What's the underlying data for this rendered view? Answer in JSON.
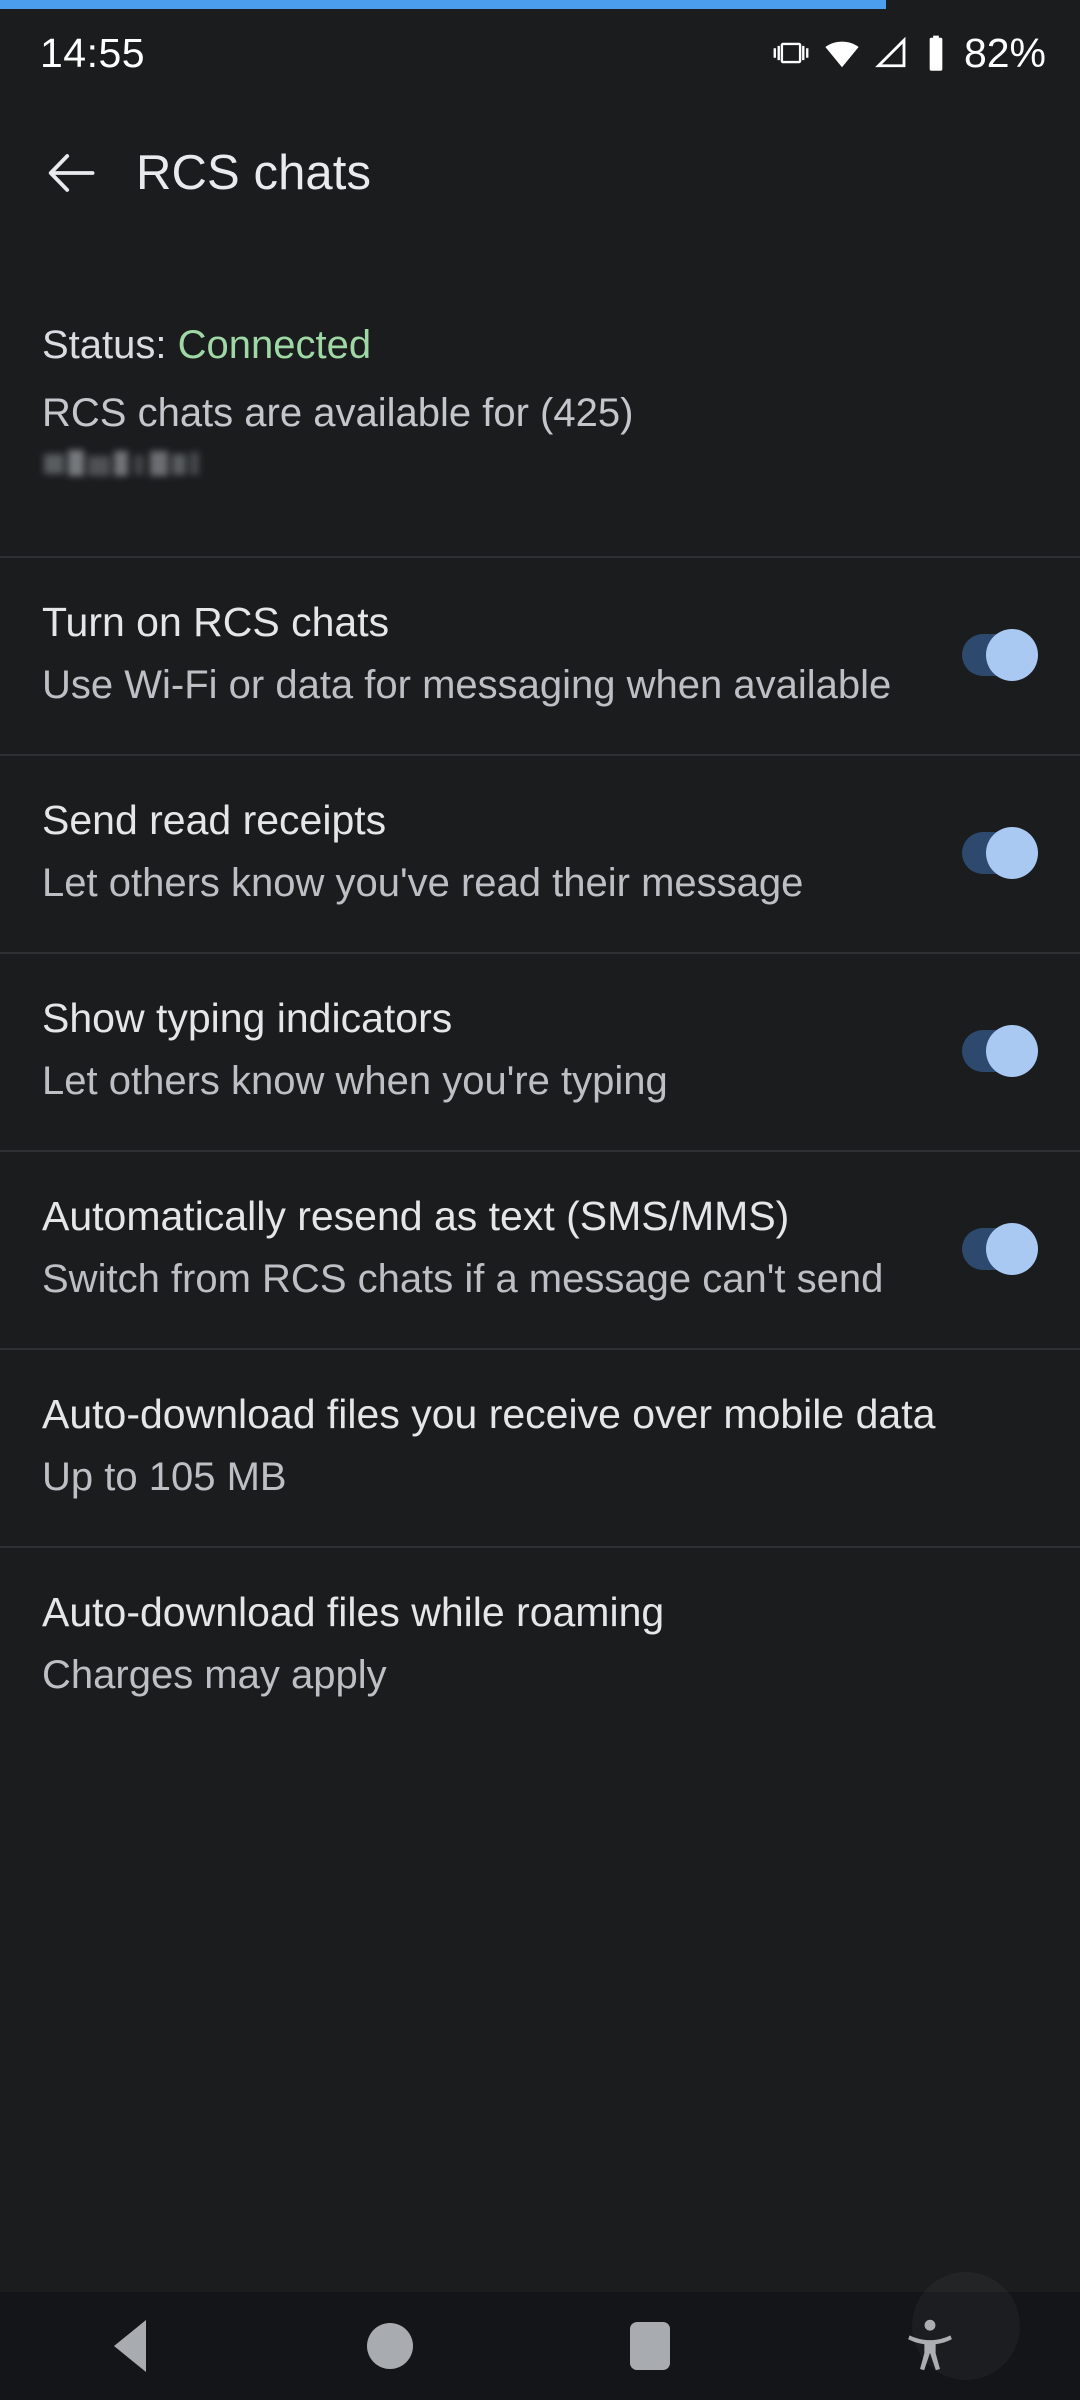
{
  "status_bar": {
    "clock": "14:55",
    "battery_percent": "82%",
    "icons": [
      "vibrate-icon",
      "wifi-icon",
      "cell-signal-icon",
      "battery-icon"
    ]
  },
  "progress": {
    "percent": 82,
    "color": "#4a9eed"
  },
  "app_bar": {
    "back_icon": "back-arrow-icon",
    "title": "RCS chats"
  },
  "status_section": {
    "status_label": "Status: ",
    "status_value": "Connected",
    "status_value_color": "#9fd8a4",
    "availability": "RCS chats are available for (425)",
    "phone_number_redacted": true
  },
  "settings": [
    {
      "title": "Turn on RCS chats",
      "subtitle": "Use Wi-Fi or data for messaging when available",
      "control": "toggle",
      "value": "on"
    },
    {
      "title": "Send read receipts",
      "subtitle": "Let others know you've read their message",
      "control": "toggle",
      "value": "on"
    },
    {
      "title": "Show typing indicators",
      "subtitle": "Let others know when you're typing",
      "control": "toggle",
      "value": "on"
    },
    {
      "title": "Automatically resend as text (SMS/MMS)",
      "subtitle": "Switch from RCS chats if a message can't send",
      "control": "toggle",
      "value": "on"
    },
    {
      "title": "Auto-download files you receive over mobile data",
      "subtitle": "Up to 105 MB",
      "control": "none",
      "value": ""
    },
    {
      "title": "Auto-download files while roaming",
      "subtitle": "Charges may apply",
      "control": "none",
      "value": ""
    }
  ],
  "nav_bar": {
    "back": "back-triangle-icon",
    "home": "home-circle-icon",
    "recents": "recents-square-icon",
    "accessibility": "accessibility-icon"
  },
  "theme": {
    "background": "#1a1c1e",
    "divider": "#2e3134",
    "toggle_track_on": "#2d4a6e",
    "toggle_thumb_on": "#a9c8f2",
    "title_text": "#e4e6e8",
    "subtitle_text": "#bcc0c4"
  }
}
